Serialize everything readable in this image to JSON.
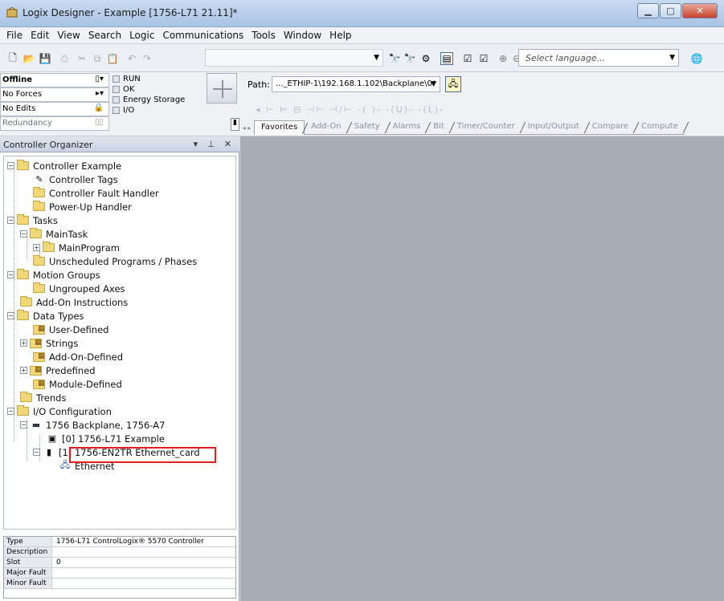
{
  "window": {
    "title": "Logix Designer - Example [1756-L71 21.11]*"
  },
  "menu": [
    "File",
    "Edit",
    "View",
    "Search",
    "Logic",
    "Communications",
    "Tools",
    "Window",
    "Help"
  ],
  "toolbar": {
    "language_placeholder": "Select language..."
  },
  "status": {
    "mode": "Offline",
    "forces": "No Forces",
    "edits": "No Edits",
    "redundancy": "Redundancy",
    "leds": [
      "RUN",
      "OK",
      "Energy Storage",
      "I/O"
    ]
  },
  "path": {
    "label": "Path:",
    "value": "..._ETHIP-1\\192.168.1.102\\Backplane\\0*"
  },
  "tabs": [
    "Favorites",
    "Add-On",
    "Safety",
    "Alarms",
    "Bit",
    "Timer/Counter",
    "Input/Output",
    "Compare",
    "Compute"
  ],
  "organizer": {
    "title": "Controller Organizer",
    "tree": [
      "Controller Example",
      "Controller Tags",
      "Controller Fault Handler",
      "Power-Up Handler",
      "Tasks",
      "MainTask",
      "MainProgram",
      "Unscheduled Programs / Phases",
      "Motion Groups",
      "Ungrouped Axes",
      "Add-On Instructions",
      "Data Types",
      "User-Defined",
      "Strings",
      "Add-On-Defined",
      "Predefined",
      "Module-Defined",
      "Trends",
      "I/O Configuration",
      "1756 Backplane, 1756-A7",
      "[0] 1756-L71 Example",
      "[1] 1756-EN2TR Ethernet_card",
      "Ethernet"
    ]
  },
  "properties": [
    {
      "key": "Type",
      "value": "1756-L71 ControlLogix® 5570 Controller"
    },
    {
      "key": "Description",
      "value": ""
    },
    {
      "key": "Slot",
      "value": "0"
    },
    {
      "key": "Major Fault",
      "value": ""
    },
    {
      "key": "Minor Fault",
      "value": ""
    }
  ]
}
